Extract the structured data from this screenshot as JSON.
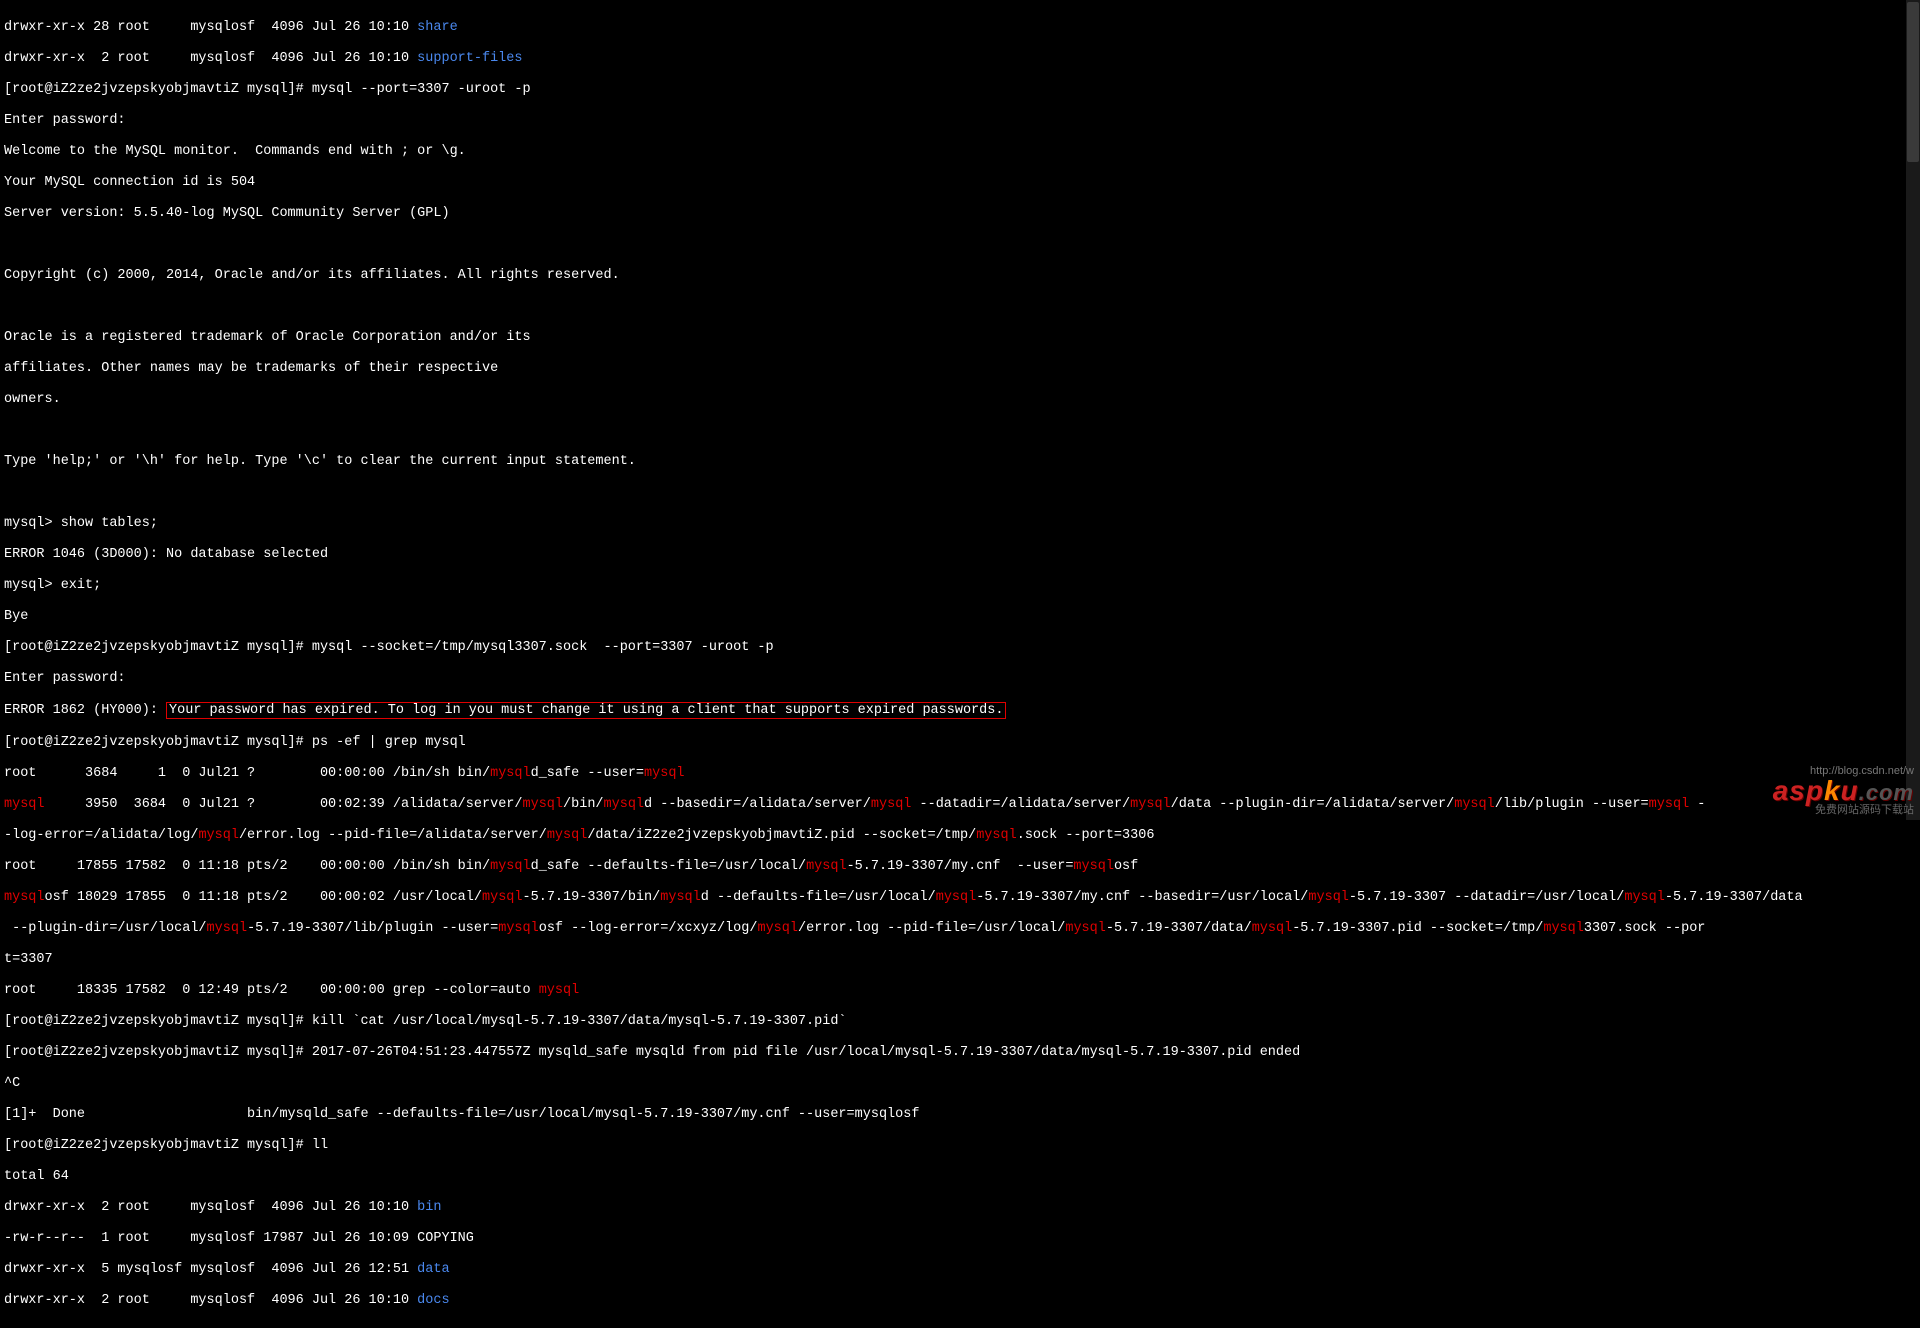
{
  "ls_top": [
    {
      "perm": "drwxr-xr-x 28 root     mysqlosf  4096 Jul 26 10:10 ",
      "name": "share"
    },
    {
      "perm": "drwxr-xr-x  2 root     mysqlosf  4096 Jul 26 10:10 ",
      "name": "support-files"
    }
  ],
  "prompt1": "[root@iZ2ze2jvzepskyobjmavtiZ mysql]# mysql --port=3307 -uroot -p",
  "enter_pw": "Enter password:",
  "welcome": "Welcome to the MySQL monitor.  Commands end with ; or \\g.",
  "conn_id": "Your MySQL connection id is 504",
  "server_ver": "Server version: 5.5.40-log MySQL Community Server (GPL)",
  "copyright": "Copyright (c) 2000, 2014, Oracle and/or its affiliates. All rights reserved.",
  "tm1": "Oracle is a registered trademark of Oracle Corporation and/or its",
  "tm2": "affiliates. Other names may be trademarks of their respective",
  "tm3": "owners.",
  "help": "Type 'help;' or '\\h' for help. Type '\\c' to clear the current input statement.",
  "mysql_show": "mysql> show tables;",
  "err1046": "ERROR 1046 (3D000): No database selected",
  "mysql_exit": "mysql> exit;",
  "bye": "Bye",
  "prompt2": "[root@iZ2ze2jvzepskyobjmavtiZ mysql]# mysql --socket=/tmp/mysql3307.sock  --port=3307 -uroot -p",
  "err1862_pre": "ERROR 1862 (HY000): ",
  "err1862_msg": "Your password has expired. To log in you must change it using a client that supports expired passwords.",
  "prompt3": "[root@iZ2ze2jvzepskyobjmavtiZ mysql]# ps -ef | grep mysql",
  "ps": {
    "l1a": "root      3684     1  0 Jul21 ?        00:00:00 /bin/sh bin/",
    "l1b": "mysql",
    "l1c": "d_safe --user=",
    "l1d": "mysql",
    "l2a": "mysql",
    "l2b": "     3950  3684  0 Jul21 ?        00:02:39 /alidata/server/",
    "l2c": "mysql",
    "l2d": "/bin/",
    "l2e": "mysql",
    "l2f": "d --basedir=/alidata/server/",
    "l2g": "mysql",
    "l2h": " --datadir=/alidata/server/",
    "l2i": "mysql",
    "l2j": "/data --plugin-dir=/alidata/server/",
    "l2k": "mysql",
    "l2l": "/lib/plugin --user=",
    "l2m": "mysql",
    "l2n": " -",
    "l2_2a": "-log-error=/alidata/log/",
    "l2_2b": "mysql",
    "l2_2c": "/error.log --pid-file=/alidata/server/",
    "l2_2d": "mysql",
    "l2_2e": "/data/iZ2ze2jvzepskyobjmavtiZ.pid --socket=/tmp/",
    "l2_2f": "mysql",
    "l2_2g": ".sock --port=3306",
    "l3a": "root     17855 17582  0 11:18 pts/2    00:00:00 /bin/sh bin/",
    "l3b": "mysql",
    "l3c": "d_safe --defaults-file=/usr/local/",
    "l3d": "mysql",
    "l3e": "-5.7.19-3307/my.cnf  --user=",
    "l3f": "mysql",
    "l3g": "osf",
    "l4a": "mysql",
    "l4b": "osf 18029 17855  0 11:18 pts/2    00:00:02 /usr/local/",
    "l4c": "mysql",
    "l4d": "-5.7.19-3307/bin/",
    "l4e": "mysql",
    "l4f": "d --defaults-file=/usr/local/",
    "l4g": "mysql",
    "l4h": "-5.7.19-3307/my.cnf --basedir=/usr/local/",
    "l4i": "mysql",
    "l4j": "-5.7.19-3307 --datadir=/usr/local/",
    "l4k": "mysql",
    "l4l": "-5.7.19-3307/data",
    "l4_2a": " --plugin-dir=/usr/local/",
    "l4_2b": "mysql",
    "l4_2c": "-5.7.19-3307/lib/plugin --user=",
    "l4_2d": "mysql",
    "l4_2e": "osf --log-error=/xcxyz/log/",
    "l4_2f": "mysql",
    "l4_2g": "/error.log --pid-file=/usr/local/",
    "l4_2h": "mysql",
    "l4_2i": "-5.7.19-3307/data/",
    "l4_2j": "mysql",
    "l4_2k": "-5.7.19-3307.pid --socket=/tmp/",
    "l4_2l": "mysql",
    "l4_2m": "3307.sock --por",
    "l4_3a": "t=3307",
    "l5a": "root     18335 17582  0 12:49 pts/2    00:00:00 grep --color=auto ",
    "l5b": "mysql"
  },
  "prompt4": "[root@iZ2ze2jvzepskyobjmavtiZ mysql]# kill `cat /usr/local/mysql-5.7.19-3307/data/mysql-5.7.19-3307.pid`",
  "prompt5": "[root@iZ2ze2jvzepskyobjmavtiZ mysql]# 2017-07-26T04:51:23.447557Z mysqld_safe mysqld from pid file /usr/local/mysql-5.7.19-3307/data/mysql-5.7.19-3307.pid ended",
  "ctrlc": "^C",
  "done": "[1]+  Done                    bin/mysqld_safe --defaults-file=/usr/local/mysql-5.7.19-3307/my.cnf --user=mysqlosf",
  "prompt6": "[root@iZ2ze2jvzepskyobjmavtiZ mysql]# ll",
  "total": "total 64",
  "ls_bottom": [
    {
      "perm": "drwxr-xr-x  2 root     mysqlosf  4096 Jul 26 10:10 ",
      "name": "bin",
      "dir": true
    },
    {
      "perm": "-rw-r--r--  1 root     mysqlosf 17987 Jul 26 10:09 COPYING",
      "name": "",
      "dir": false
    },
    {
      "perm": "drwxr-xr-x  5 mysqlosf mysqlosf  4096 Jul 26 12:51 ",
      "name": "data",
      "dir": true
    },
    {
      "perm": "drwxr-xr-x  2 root     mysqlosf  4096 Jul 26 10:10 ",
      "name": "docs",
      "dir": true
    }
  ],
  "watermark": {
    "brand_a": "asp",
    "brand_k": "k",
    "brand_u": "u",
    "brand_dot": ".com",
    "tag": "免费网站源码下载站",
    "url": "http://blog.csdn.net/w"
  }
}
